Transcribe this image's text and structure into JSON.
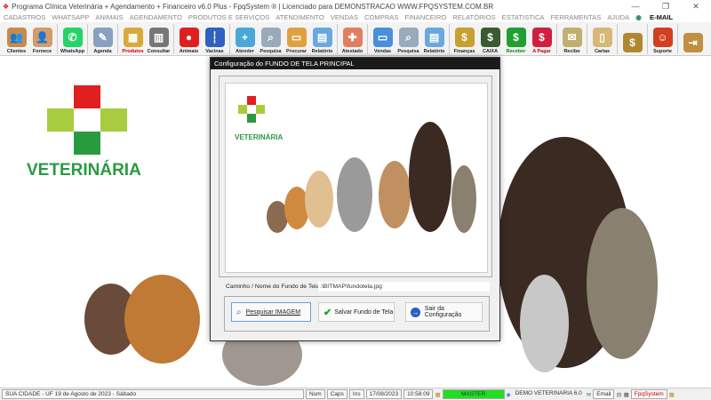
{
  "title": "Programa Clínica Veterinária + Agendamento + Financeiro v6.0 Plus - FpqSystem ® | Licenciado para  DEMONSTRACAO WWW.FPQSYSTEM.COM.BR",
  "menu": [
    "CADASTROS",
    "WHATSAPP",
    "ANIMAIS",
    "AGENDAMENTO",
    "PRODUTOS E SERVIÇOS",
    "ATENDIMENTO",
    "VENDAS",
    "COMPRAS",
    "FINANCEIRO",
    "RELATÓRIOS",
    "ESTATISTICA",
    "FERRAMENTAS",
    "AJUDA"
  ],
  "menu_email": "E-MAIL",
  "toolbar": [
    {
      "label": "Clientes",
      "icon": "clients-icon",
      "color": "#c98a4a",
      "glyph": "👥"
    },
    {
      "label": "Fornece",
      "icon": "supplier-icon",
      "color": "#d49b6b",
      "glyph": "👤"
    },
    {
      "sep": true
    },
    {
      "label": "WhatsApp",
      "icon": "whatsapp-icon",
      "color": "#25d366",
      "glyph": "✆"
    },
    {
      "sep": true
    },
    {
      "label": "Agenda",
      "icon": "calendar-icon",
      "color": "#8aa0c0",
      "glyph": "✎"
    },
    {
      "sep": true
    },
    {
      "label": "Produtos",
      "icon": "boxes-icon",
      "color": "#d9a93a",
      "glyph": "▦"
    },
    {
      "label": "Consultar",
      "icon": "barcode-icon",
      "color": "#777",
      "glyph": "▥"
    },
    {
      "sep": true
    },
    {
      "label": "Animais",
      "icon": "paw-icon",
      "color": "#e02020",
      "glyph": "●"
    },
    {
      "label": "Vacinas",
      "icon": "syringe-icon",
      "color": "#3060c0",
      "glyph": "┆"
    },
    {
      "sep": true
    },
    {
      "label": "Atender",
      "icon": "paw-plus-icon",
      "color": "#4aa8d8",
      "glyph": "+"
    },
    {
      "label": "Pesquisa",
      "icon": "search-docs-icon",
      "color": "#9ab",
      "glyph": "⌕"
    },
    {
      "label": "Procurar",
      "icon": "folder-icon",
      "color": "#e0a040",
      "glyph": "▭"
    },
    {
      "label": "Relatório",
      "icon": "printer-icon",
      "color": "#6aa8e0",
      "glyph": "▤"
    },
    {
      "sep": true
    },
    {
      "label": "Atestado",
      "icon": "certificate-icon",
      "color": "#e08060",
      "glyph": "✚"
    },
    {
      "sep": true
    },
    {
      "label": "Vendas",
      "icon": "monitor-icon",
      "color": "#4a90d8",
      "glyph": "▭"
    },
    {
      "label": "Pesquisa",
      "icon": "search-docs-icon",
      "color": "#9ab",
      "glyph": "⌕"
    },
    {
      "label": "Relatório",
      "icon": "printer-icon",
      "color": "#6aa8e0",
      "glyph": "▤"
    },
    {
      "sep": true
    },
    {
      "label": "Finanças",
      "icon": "finance-chart-icon",
      "color": "#c8a030",
      "glyph": "$"
    },
    {
      "label": "CAIXA",
      "icon": "cashbook-icon",
      "color": "#3a5a30",
      "glyph": "$"
    },
    {
      "label": "Receber",
      "icon": "receive-money-icon",
      "color": "#20a030",
      "glyph": "$"
    },
    {
      "label": "A Pagar",
      "icon": "pay-money-icon",
      "color": "#d02040",
      "glyph": "$"
    },
    {
      "sep": true
    },
    {
      "label": "Recibo",
      "icon": "receipt-icon",
      "color": "#c0b070",
      "glyph": "✉"
    },
    {
      "sep": true
    },
    {
      "label": "Cartas",
      "icon": "letter-icon",
      "color": "#d8b878",
      "glyph": "▯"
    },
    {
      "sep": true
    },
    {
      "label": "",
      "icon": "coins-icon",
      "color": "#b08830",
      "glyph": "$"
    },
    {
      "sep": true
    },
    {
      "label": "Suporte",
      "icon": "support-icon",
      "color": "#d04020",
      "glyph": "☺"
    },
    {
      "sep": true
    },
    {
      "label": "",
      "icon": "exit-door-icon",
      "color": "#c09040",
      "glyph": "⇥"
    }
  ],
  "logo_text": "VETERINÁRIA",
  "dialog": {
    "title": "Configuração do FUNDO DE TELA PRINCIPAL",
    "path_label": "Caminho / Nome do Fundo de Tela",
    "path_value": ".\\BITMAP\\fundotela.jpg",
    "btn_search": "Pesquisar IMAGEM",
    "btn_save": "Salvar Fundo de Tela",
    "btn_exit": "Sair da Configuração"
  },
  "status": {
    "location": "SUA CIDADE - UF 19 de Agosto de 2023 - Sábado",
    "num": "Num",
    "caps": "Caps",
    "ins": "Ins",
    "date": "17/08/2023",
    "time": "10:58:09",
    "user": "MASTER",
    "company": "DEMO VETERINARIA 6.0",
    "email": "Email",
    "brand": "FpqSystem"
  },
  "colors": {
    "master_bg": "#22dd22",
    "dialog_title_bg": "#1a1a1a",
    "brand": "#d00000"
  }
}
